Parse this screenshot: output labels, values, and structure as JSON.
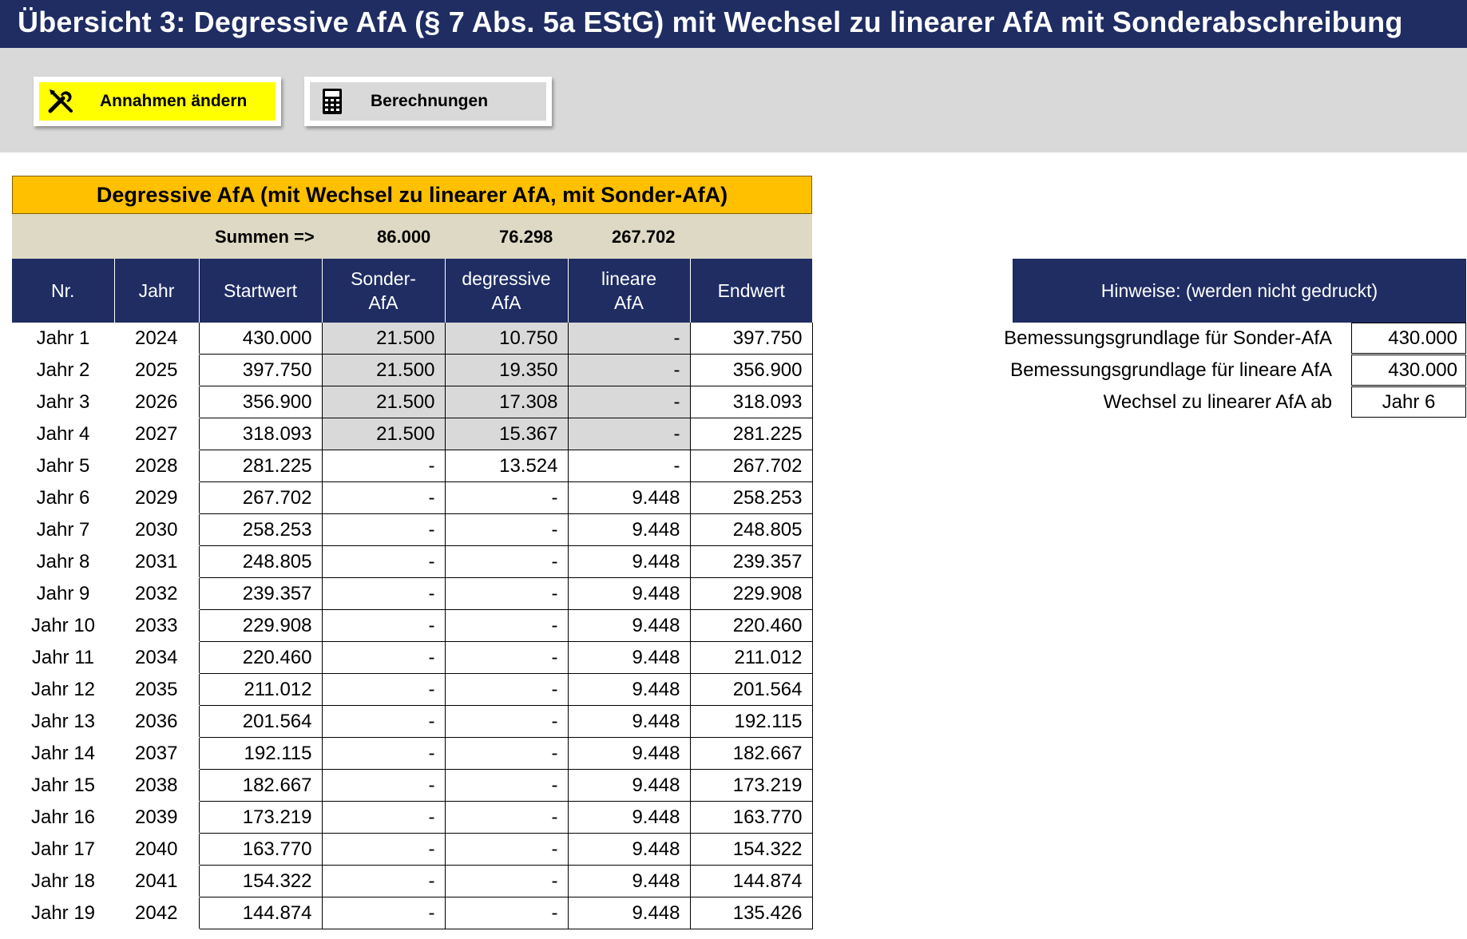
{
  "title": "Übersicht 3: Degressive AfA (§ 7 Abs. 5a EStG) mit Wechsel zu linearer AfA mit Sonderabschreibung",
  "toolbar": {
    "annahmen_label": "Annahmen ändern",
    "berechnungen_label": "Berechnungen",
    "annahmen_icon": "tools-icon",
    "berechnungen_icon": "calculator-icon"
  },
  "table": {
    "title": "Degressive AfA (mit Wechsel zu linearer AfA, mit Sonder-AfA)",
    "sums_label": "Summen =>",
    "sum_sonder": "86.000",
    "sum_degressiv": "76.298",
    "sum_linear": "267.702",
    "headers": {
      "nr": "Nr.",
      "jahr": "Jahr",
      "startwert": "Startwert",
      "sonder_1": "Sonder-",
      "sonder_2": "AfA",
      "degressiv_1": "degressive",
      "degressiv_2": "AfA",
      "linear_1": "lineare",
      "linear_2": "AfA",
      "endwert": "Endwert"
    },
    "rows": [
      {
        "nr": "Jahr 1",
        "jahr": "2024",
        "start": "430.000",
        "sonder": "21.500",
        "degressiv": "10.750",
        "linear": "-",
        "end": "397.750"
      },
      {
        "nr": "Jahr 2",
        "jahr": "2025",
        "start": "397.750",
        "sonder": "21.500",
        "degressiv": "19.350",
        "linear": "-",
        "end": "356.900"
      },
      {
        "nr": "Jahr 3",
        "jahr": "2026",
        "start": "356.900",
        "sonder": "21.500",
        "degressiv": "17.308",
        "linear": "-",
        "end": "318.093"
      },
      {
        "nr": "Jahr 4",
        "jahr": "2027",
        "start": "318.093",
        "sonder": "21.500",
        "degressiv": "15.367",
        "linear": "-",
        "end": "281.225"
      },
      {
        "nr": "Jahr 5",
        "jahr": "2028",
        "start": "281.225",
        "sonder": "-",
        "degressiv": "13.524",
        "linear": "-",
        "end": "267.702"
      },
      {
        "nr": "Jahr 6",
        "jahr": "2029",
        "start": "267.702",
        "sonder": "-",
        "degressiv": "-",
        "linear": "9.448",
        "end": "258.253"
      },
      {
        "nr": "Jahr 7",
        "jahr": "2030",
        "start": "258.253",
        "sonder": "-",
        "degressiv": "-",
        "linear": "9.448",
        "end": "248.805"
      },
      {
        "nr": "Jahr 8",
        "jahr": "2031",
        "start": "248.805",
        "sonder": "-",
        "degressiv": "-",
        "linear": "9.448",
        "end": "239.357"
      },
      {
        "nr": "Jahr 9",
        "jahr": "2032",
        "start": "239.357",
        "sonder": "-",
        "degressiv": "-",
        "linear": "9.448",
        "end": "229.908"
      },
      {
        "nr": "Jahr 10",
        "jahr": "2033",
        "start": "229.908",
        "sonder": "-",
        "degressiv": "-",
        "linear": "9.448",
        "end": "220.460"
      },
      {
        "nr": "Jahr 11",
        "jahr": "2034",
        "start": "220.460",
        "sonder": "-",
        "degressiv": "-",
        "linear": "9.448",
        "end": "211.012"
      },
      {
        "nr": "Jahr 12",
        "jahr": "2035",
        "start": "211.012",
        "sonder": "-",
        "degressiv": "-",
        "linear": "9.448",
        "end": "201.564"
      },
      {
        "nr": "Jahr 13",
        "jahr": "2036",
        "start": "201.564",
        "sonder": "-",
        "degressiv": "-",
        "linear": "9.448",
        "end": "192.115"
      },
      {
        "nr": "Jahr 14",
        "jahr": "2037",
        "start": "192.115",
        "sonder": "-",
        "degressiv": "-",
        "linear": "9.448",
        "end": "182.667"
      },
      {
        "nr": "Jahr 15",
        "jahr": "2038",
        "start": "182.667",
        "sonder": "-",
        "degressiv": "-",
        "linear": "9.448",
        "end": "173.219"
      },
      {
        "nr": "Jahr 16",
        "jahr": "2039",
        "start": "173.219",
        "sonder": "-",
        "degressiv": "-",
        "linear": "9.448",
        "end": "163.770"
      },
      {
        "nr": "Jahr 17",
        "jahr": "2040",
        "start": "163.770",
        "sonder": "-",
        "degressiv": "-",
        "linear": "9.448",
        "end": "154.322"
      },
      {
        "nr": "Jahr 18",
        "jahr": "2041",
        "start": "154.322",
        "sonder": "-",
        "degressiv": "-",
        "linear": "9.448",
        "end": "144.874"
      },
      {
        "nr": "Jahr 19",
        "jahr": "2042",
        "start": "144.874",
        "sonder": "-",
        "degressiv": "-",
        "linear": "9.448",
        "end": "135.426"
      }
    ]
  },
  "hinweise": {
    "title": "Hinweise:  (werden nicht gedruckt)",
    "items": [
      {
        "label": "Bemessungsgrundlage für Sonder-AfA",
        "value": "430.000"
      },
      {
        "label": "Bemessungsgrundlage für lineare AfA",
        "value": "430.000"
      },
      {
        "label": "Wechsel zu linearer AfA ab",
        "value": "Jahr 6"
      }
    ]
  }
}
